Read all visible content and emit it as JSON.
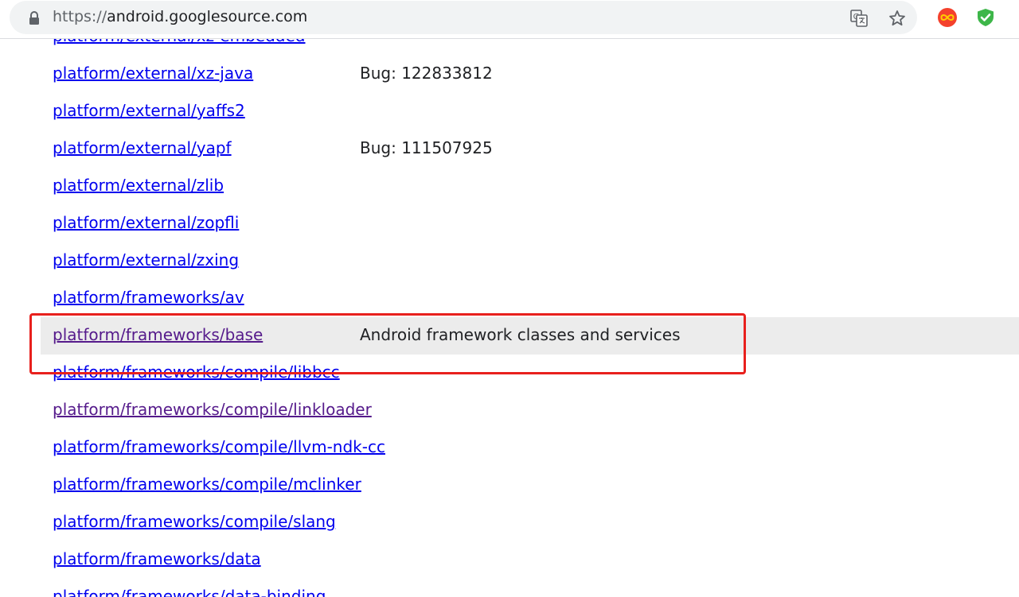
{
  "browser": {
    "url_scheme": "https://",
    "url_host": "android.googlesource.com",
    "icons": {
      "lock": "lock-icon",
      "translate": "translate-icon",
      "bookmark": "star-icon",
      "extension_1": "infinity-extension-icon",
      "extension_2": "shield-extension-icon"
    },
    "colors": {
      "link": "#0000ee",
      "visited_link": "#551a8b",
      "highlight_row": "#ececec",
      "annotation_box": "#e8201d"
    }
  },
  "repo_list": [
    {
      "name": "platform/external/xz-embedded",
      "description": "",
      "visited": false,
      "highlighted": false
    },
    {
      "name": "platform/external/xz-java",
      "description": "Bug: 122833812",
      "visited": false,
      "highlighted": false
    },
    {
      "name": "platform/external/yaffs2",
      "description": "",
      "visited": false,
      "highlighted": false
    },
    {
      "name": "platform/external/yapf",
      "description": "Bug: 111507925",
      "visited": false,
      "highlighted": false
    },
    {
      "name": "platform/external/zlib",
      "description": "",
      "visited": false,
      "highlighted": false
    },
    {
      "name": "platform/external/zopfli",
      "description": "",
      "visited": false,
      "highlighted": false
    },
    {
      "name": "platform/external/zxing",
      "description": "",
      "visited": false,
      "highlighted": false
    },
    {
      "name": "platform/frameworks/av",
      "description": "",
      "visited": false,
      "highlighted": false
    },
    {
      "name": "platform/frameworks/base",
      "description": "Android framework classes and services",
      "visited": true,
      "highlighted": true
    },
    {
      "name": "platform/frameworks/compile/libbcc",
      "description": "",
      "visited": false,
      "highlighted": false
    },
    {
      "name": "platform/frameworks/compile/linkloader",
      "description": "",
      "visited": true,
      "highlighted": false
    },
    {
      "name": "platform/frameworks/compile/llvm-ndk-cc",
      "description": "",
      "visited": false,
      "highlighted": false
    },
    {
      "name": "platform/frameworks/compile/mclinker",
      "description": "",
      "visited": false,
      "highlighted": false
    },
    {
      "name": "platform/frameworks/compile/slang",
      "description": "",
      "visited": false,
      "highlighted": false
    },
    {
      "name": "platform/frameworks/data",
      "description": "",
      "visited": false,
      "highlighted": false
    },
    {
      "name": "platform/frameworks/data-binding",
      "description": "",
      "visited": false,
      "highlighted": false
    }
  ]
}
